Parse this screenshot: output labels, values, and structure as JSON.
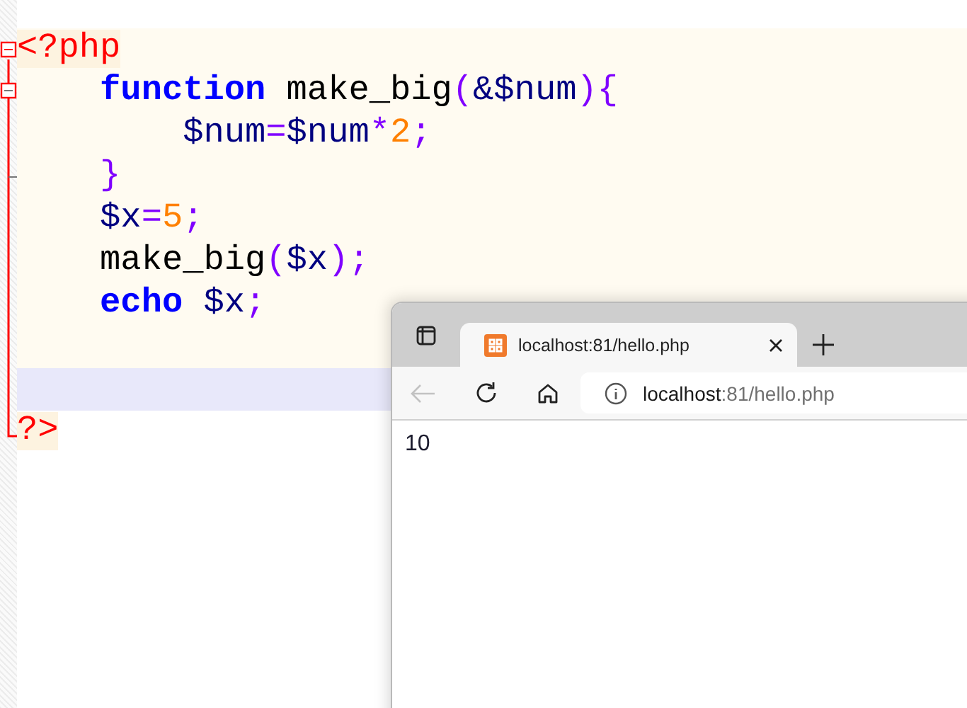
{
  "editor": {
    "lines": [
      {
        "current": false,
        "tokens": [
          {
            "kind": "tag",
            "text": "<?php"
          }
        ]
      },
      {
        "current": false,
        "tokens": [
          {
            "kind": "keyword",
            "text": "    function"
          },
          {
            "kind": "plain",
            "text": " make_big"
          },
          {
            "kind": "op",
            "text": "("
          },
          {
            "kind": "var",
            "text": "&$num"
          },
          {
            "kind": "op",
            "text": "){"
          }
        ]
      },
      {
        "current": false,
        "tokens": [
          {
            "kind": "var",
            "text": "        $num"
          },
          {
            "kind": "op",
            "text": "="
          },
          {
            "kind": "var",
            "text": "$num"
          },
          {
            "kind": "op",
            "text": "*"
          },
          {
            "kind": "number",
            "text": "2"
          },
          {
            "kind": "op",
            "text": ";"
          }
        ]
      },
      {
        "current": false,
        "tokens": [
          {
            "kind": "op",
            "text": "    }"
          }
        ]
      },
      {
        "current": false,
        "tokens": [
          {
            "kind": "var",
            "text": "    $x"
          },
          {
            "kind": "op",
            "text": "="
          },
          {
            "kind": "number",
            "text": "5"
          },
          {
            "kind": "op",
            "text": ";"
          }
        ]
      },
      {
        "current": false,
        "tokens": [
          {
            "kind": "plain",
            "text": "    make_big"
          },
          {
            "kind": "op",
            "text": "("
          },
          {
            "kind": "var",
            "text": "$x"
          },
          {
            "kind": "op",
            "text": ");"
          }
        ]
      },
      {
        "current": false,
        "tokens": [
          {
            "kind": "keyword",
            "text": "    echo"
          },
          {
            "kind": "var",
            "text": " $x"
          },
          {
            "kind": "op",
            "text": ";"
          }
        ]
      },
      {
        "current": false
      },
      {
        "current": true
      },
      {
        "current": false,
        "tokens": [
          {
            "kind": "tag",
            "text": "?>"
          }
        ]
      }
    ]
  },
  "browser": {
    "tabs": [
      {
        "title": "localhost:81/hello.php",
        "selected": true
      }
    ],
    "back_disabled": true,
    "address": {
      "host": "localhost",
      "rest": ":81/hello.php"
    },
    "content": "10"
  }
}
